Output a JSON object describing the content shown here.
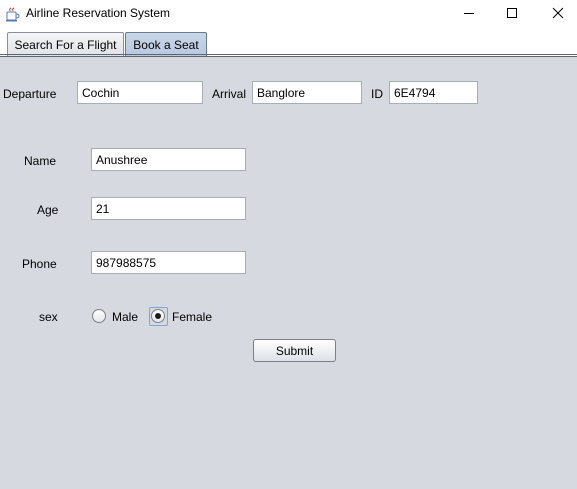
{
  "window": {
    "title": "Airline Reservation System"
  },
  "tabs": [
    {
      "label": "Search For a Flight",
      "selected": false
    },
    {
      "label": "Book a Seat",
      "selected": true
    }
  ],
  "flight": {
    "departure_label": "Departure",
    "departure_value": "Cochin",
    "arrival_label": "Arrival",
    "arrival_value": "Banglore",
    "id_label": "ID",
    "id_value": "6E4794"
  },
  "form": {
    "name_label": "Name",
    "name_value": "Anushree",
    "age_label": "Age",
    "age_value": "21",
    "phone_label": "Phone",
    "phone_value": "987988575",
    "sex_label": "sex",
    "sex_options": [
      {
        "label": "Male",
        "selected": false
      },
      {
        "label": "Female",
        "selected": true
      }
    ],
    "submit_label": "Submit"
  },
  "icons": {
    "app": "java-cup-icon",
    "minimize": "minimize-icon",
    "maximize": "maximize-icon",
    "close": "close-icon"
  },
  "colors": {
    "background": "#d6d9df",
    "selected_tab": "#b8c9e0"
  }
}
